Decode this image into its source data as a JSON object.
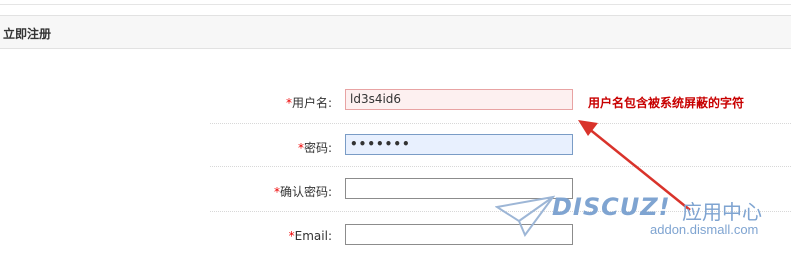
{
  "section_title": "立即注册",
  "form": {
    "required_mark": "*",
    "username": {
      "label": "用户名:",
      "value": "ld3s4id6",
      "error": "用户名包含被系统屏蔽的字符"
    },
    "password": {
      "label": "密码:",
      "value": "•••••••"
    },
    "confirm_password": {
      "label": "确认密码:",
      "value": ""
    },
    "email": {
      "label": "Email:",
      "value": ""
    }
  },
  "watermark": {
    "brand": "DISCUZ!",
    "tagline": "应用中心",
    "url": "addon.dismall.com"
  },
  "colors": {
    "error": "#c80000",
    "required": "#e00000",
    "arrow": "#d9332b",
    "watermark": "#7fa4d1"
  }
}
